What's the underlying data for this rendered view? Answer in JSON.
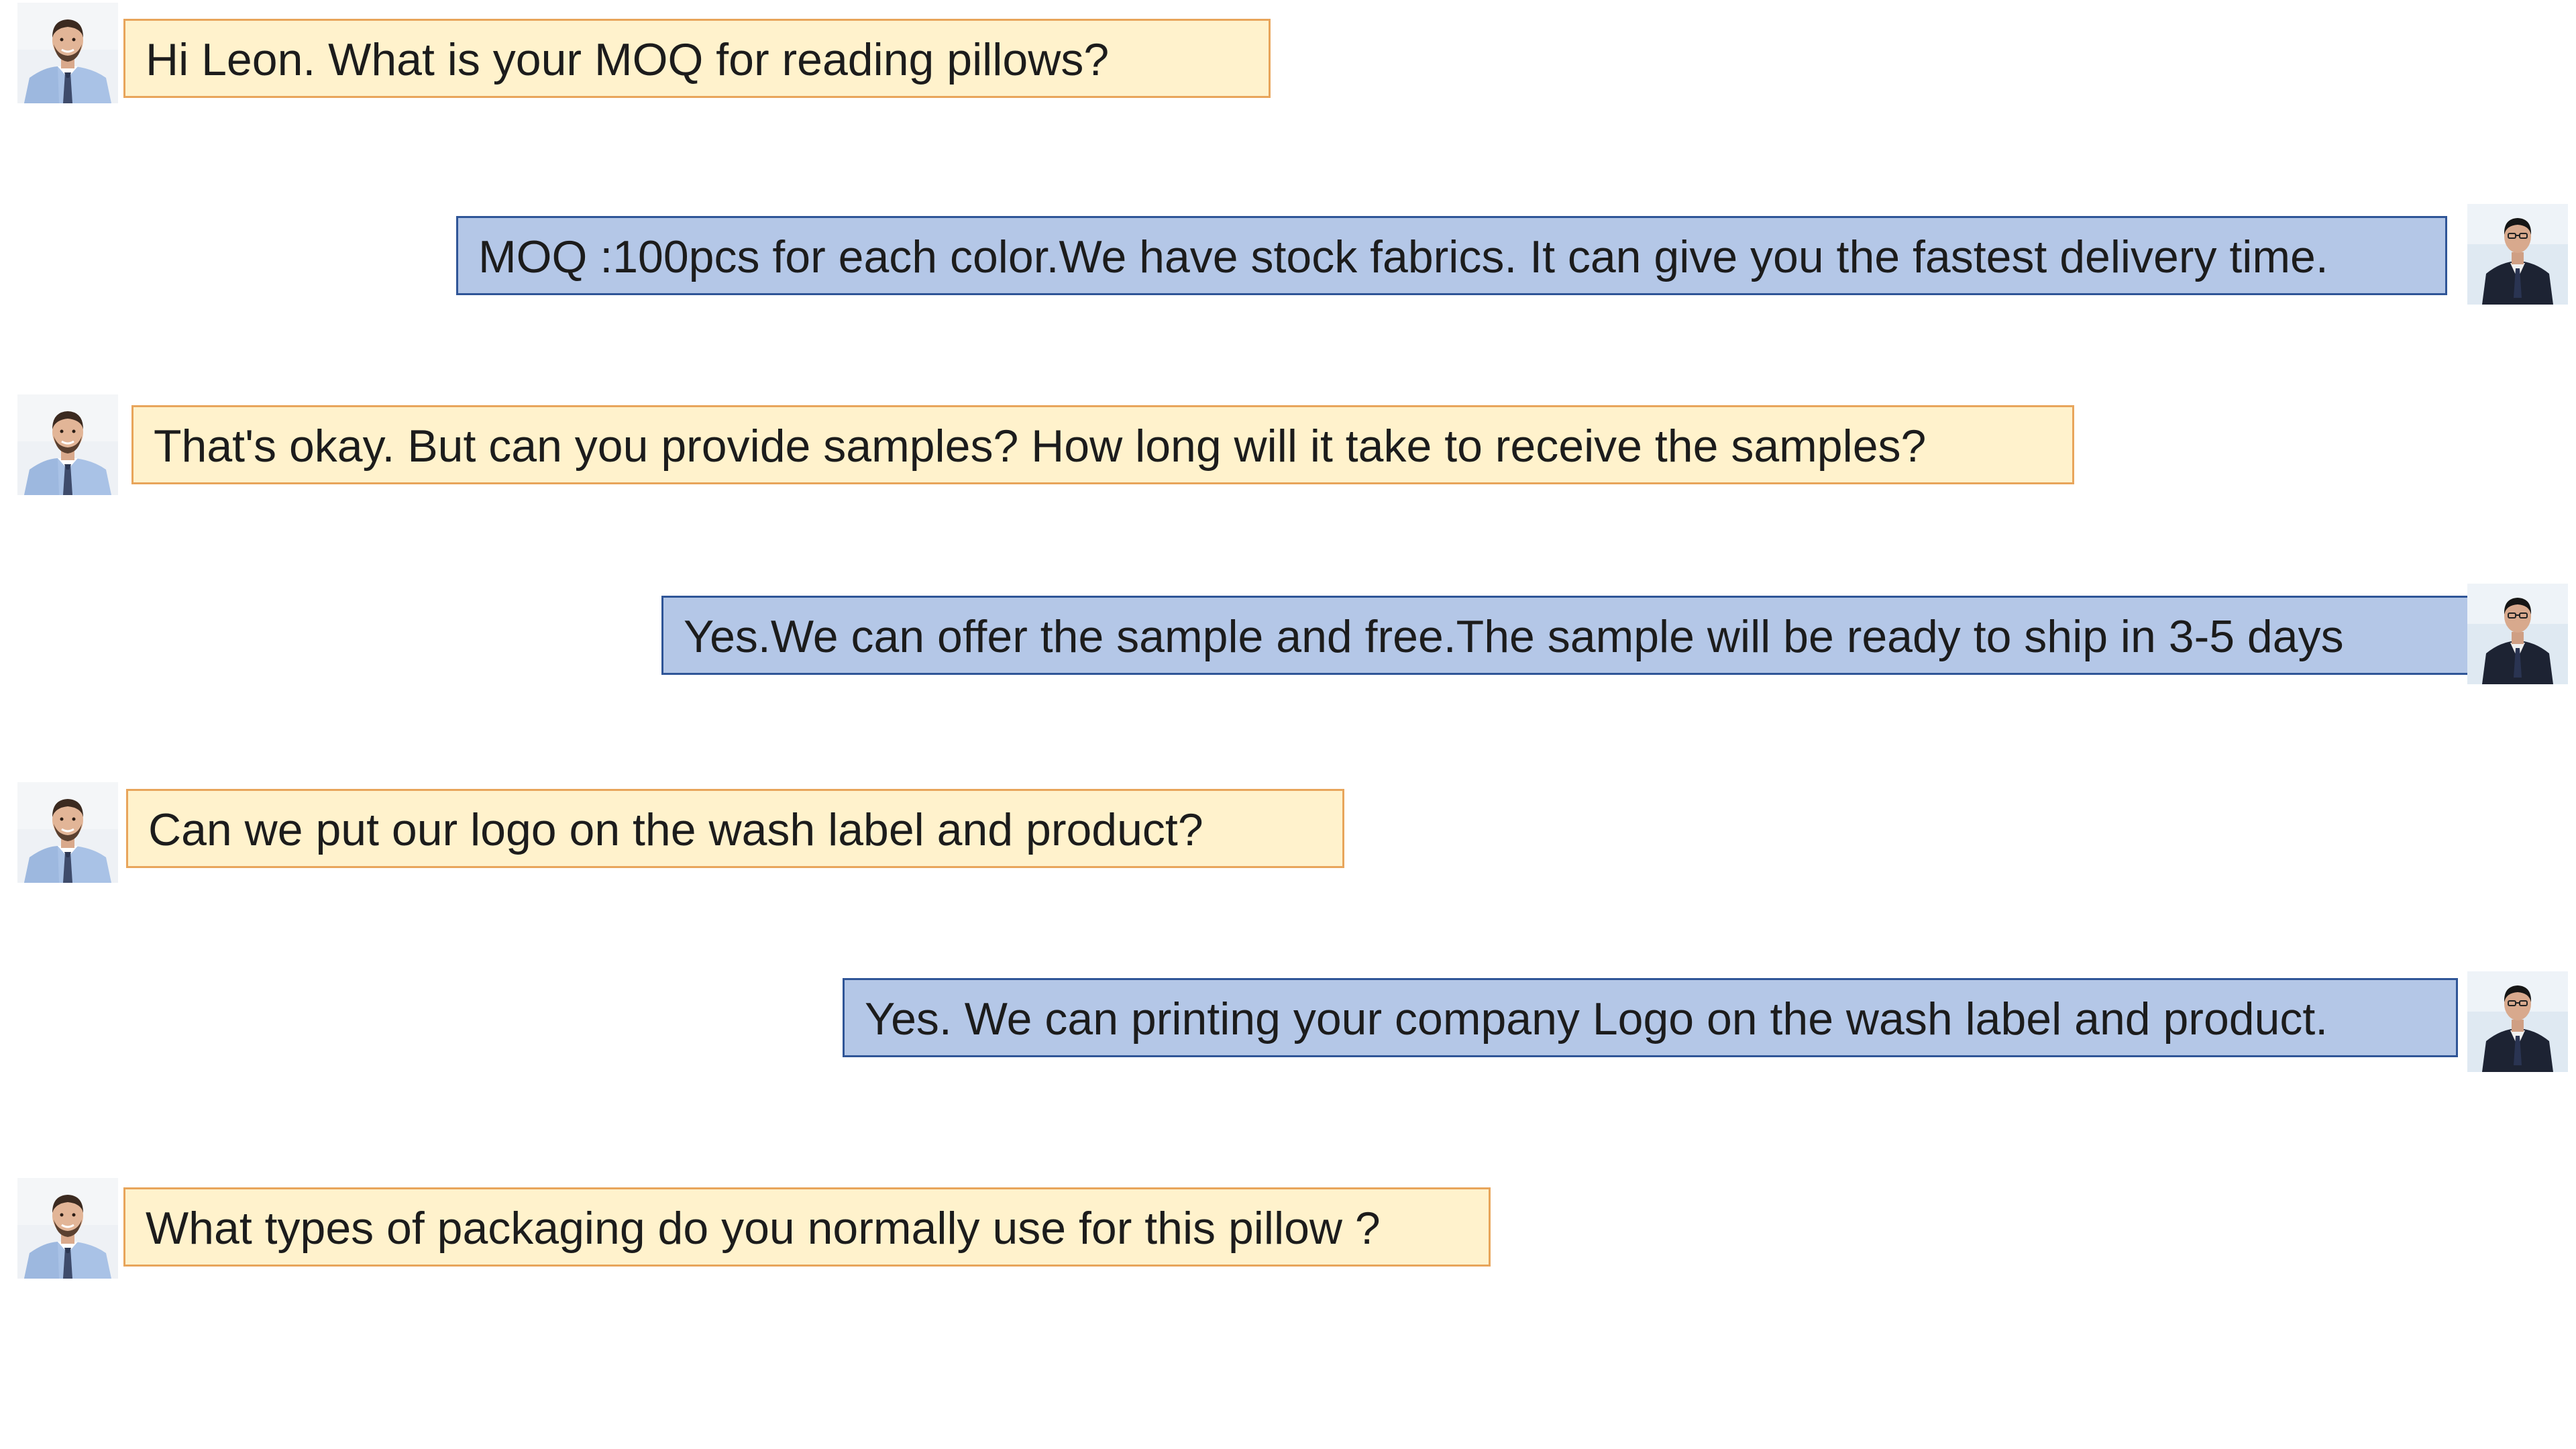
{
  "colors": {
    "customer_bubble_bg": "#fff2cc",
    "customer_bubble_border": "#e8a55b",
    "agent_bubble_bg": "#b4c7e7",
    "agent_bubble_border": "#2f5597"
  },
  "icons": {
    "customer_avatar": "customer-avatar-icon",
    "agent_avatar": "agent-avatar-icon"
  },
  "messages": [
    {
      "sender": "customer",
      "text": "Hi Leon. What is your MOQ for reading pillows?"
    },
    {
      "sender": "agent",
      "text": "MOQ :100pcs for each color.We have stock fabrics. It can give you the fastest delivery time."
    },
    {
      "sender": "customer",
      "text": "That's okay. But can you provide samples? How long will it take to receive the samples?"
    },
    {
      "sender": "agent",
      "text": "Yes.We can offer the sample and free.The sample will be ready to ship in 3-5 days"
    },
    {
      "sender": "customer",
      "text": "Can we put our logo on the wash label and product?"
    },
    {
      "sender": "agent",
      "text": "Yes. We can printing your company Logo on the wash label and product."
    },
    {
      "sender": "customer",
      "text": "What types of packaging do you normally use for this pillow ?"
    }
  ]
}
